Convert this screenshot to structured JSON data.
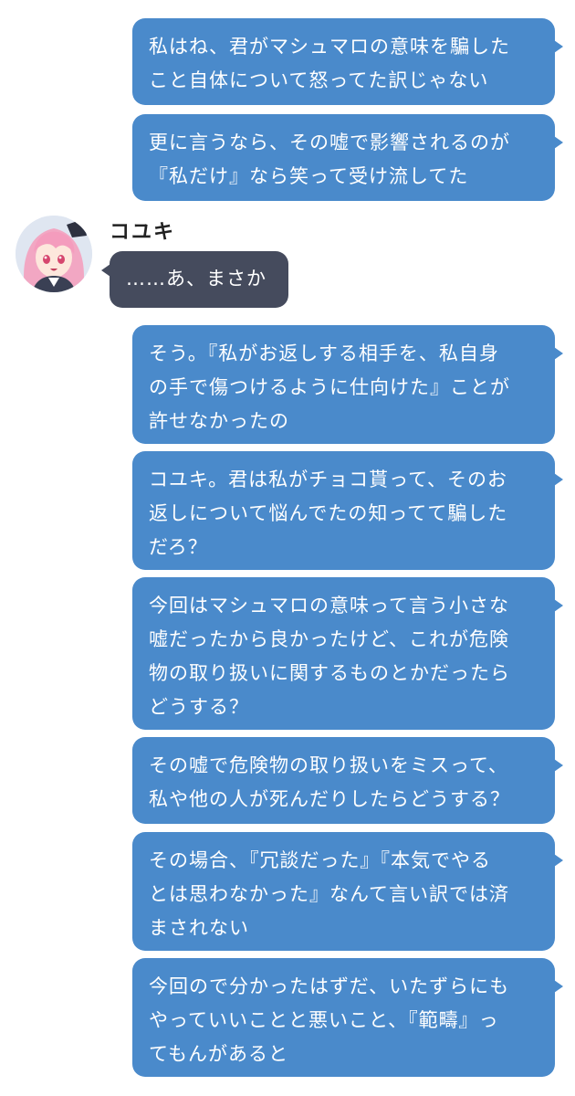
{
  "messages": [
    {
      "side": "right",
      "lines": [
        "私はね、君がマシュマロの意味を騙した",
        "こと自体について怒ってた訳じゃない"
      ]
    },
    {
      "side": "right",
      "lines": [
        "更に言うなら、その嘘で影響されるのが",
        "『私だけ』なら笑って受け流してた"
      ]
    },
    {
      "side": "left",
      "sender": "コユキ",
      "lines": [
        "……あ、まさか"
      ]
    },
    {
      "side": "right",
      "lines": [
        "そう。『私がお返しする相手を、私自身",
        "の手で傷つけるように仕向けた』ことが",
        "許せなかったの"
      ]
    },
    {
      "side": "right",
      "lines": [
        "コユキ。君は私がチョコ貰って、そのお",
        "返しについて悩んでたの知ってて騙した",
        "だろ？"
      ]
    },
    {
      "side": "right",
      "lines": [
        "今回はマシュマロの意味って言う小さな",
        "嘘だったから良かったけど、これが危険",
        "物の取り扱いに関するものとかだったら",
        "どうする？"
      ]
    },
    {
      "side": "right",
      "lines": [
        "その嘘で危険物の取り扱いをミスって、",
        "私や他の人が死んだりしたらどうする？"
      ]
    },
    {
      "side": "right",
      "lines": [
        "その場合、『冗談だった』『本気でやる",
        "とは思わなかった』なんて言い訳では済",
        "まされない"
      ]
    },
    {
      "side": "right",
      "lines": [
        "今回ので分かったはずだ、いたずらにも",
        "やっていいことと悪いこと、『範疇』っ",
        "てもんがあると"
      ]
    }
  ],
  "colors": {
    "outgoing_bubble": "#4a8acb",
    "incoming_bubble": "#454b5d",
    "bubble_text": "#ffffff",
    "background": "#ffffff"
  },
  "icons": {
    "avatar": "avatar-pink-hair-girl"
  }
}
